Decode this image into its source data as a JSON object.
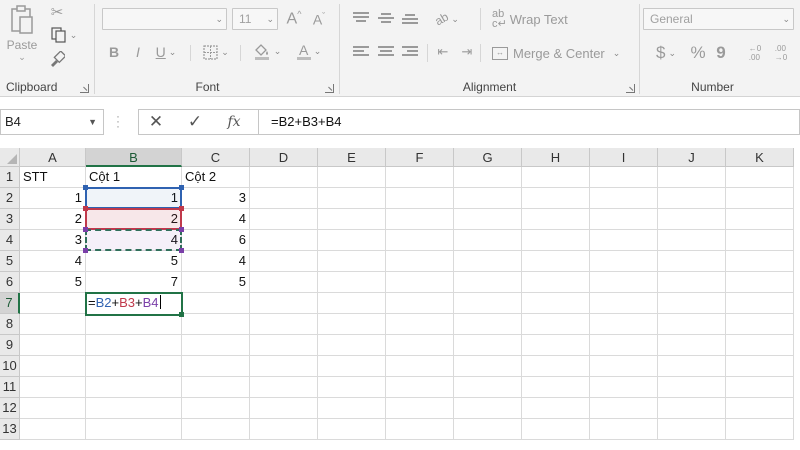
{
  "ribbon": {
    "clipboard": {
      "label": "Clipboard",
      "paste_label": "Paste"
    },
    "font": {
      "label": "Font",
      "font_name": "",
      "font_size": "11",
      "bold": "B",
      "italic": "I",
      "underline": "U"
    },
    "alignment": {
      "label": "Alignment",
      "wrap_text": "Wrap Text",
      "merge_center": "Merge & Center"
    },
    "number": {
      "label": "Number",
      "format": "General",
      "currency": "$",
      "percent": "%",
      "comma": "9"
    }
  },
  "formula_bar": {
    "name_box": "B4",
    "cancel": "✕",
    "enter": "✓",
    "fx": "fx",
    "formula": "=B2+B3+B4"
  },
  "grid": {
    "columns": [
      "A",
      "B",
      "C",
      "D",
      "E",
      "F",
      "G",
      "H",
      "I",
      "J",
      "K"
    ],
    "rows": [
      "1",
      "2",
      "3",
      "4",
      "5",
      "6",
      "7",
      "8",
      "9",
      "10",
      "11",
      "12",
      "13"
    ],
    "selected_column": "B",
    "selected_row": "7",
    "cells": {
      "A1": "STT",
      "B1": "Cột 1",
      "C1": "Cột 2",
      "A2": "1",
      "B2": "1",
      "C2": "3",
      "A3": "2",
      "B3": "2",
      "C3": "4",
      "A4": "3",
      "B4": "4",
      "C4": "6",
      "A5": "4",
      "B5": "5",
      "C5": "4",
      "A6": "5",
      "B6": "7",
      "C6": "5"
    },
    "editing_cell": {
      "ref": "B7",
      "tokens": [
        {
          "text": "=",
          "ref": ""
        },
        {
          "text": "B2",
          "ref": "B2"
        },
        {
          "text": "+",
          "ref": ""
        },
        {
          "text": "B3",
          "ref": "B3"
        },
        {
          "text": "+",
          "ref": ""
        },
        {
          "text": "B4",
          "ref": "B4"
        }
      ]
    },
    "reference_colors": {
      "B2": "#2f62b1",
      "B3": "#c0394b",
      "B4": "#7a3fa8"
    },
    "accent_color": "#217346"
  }
}
